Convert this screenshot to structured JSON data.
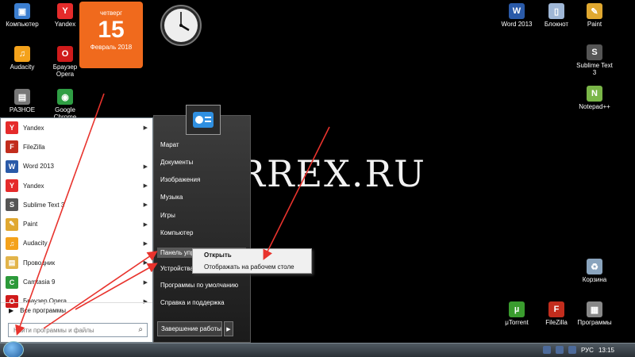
{
  "desktop": {
    "left_icons": [
      {
        "label": "Компьютер",
        "glyph": "▣",
        "color": "#3b7ed0"
      },
      {
        "label": "Yandex",
        "glyph": "Y",
        "color": "#e52b2b"
      },
      {
        "label": "Audacity",
        "glyph": "♫",
        "color": "#f4a21b"
      },
      {
        "label": "Браузер Opera",
        "glyph": "O",
        "color": "#d01b1b"
      },
      {
        "label": "РАЗНОЕ",
        "glyph": "▤",
        "color": "#777777"
      },
      {
        "label": "Google Chrome",
        "glyph": "◉",
        "color": "#2f9e44"
      }
    ],
    "right_icons": [
      {
        "label": "Word 2013",
        "glyph": "W",
        "color": "#2a5aa8"
      },
      {
        "label": "Блокнот",
        "glyph": "▯",
        "color": "#9fb7d6"
      },
      {
        "label": "Paint",
        "glyph": "✎",
        "color": "#e0a830"
      },
      {
        "label": "Sublime Text 3",
        "glyph": "S",
        "color": "#555555"
      },
      {
        "label": "Notepad++",
        "glyph": "N",
        "color": "#7ab648"
      },
      {
        "label": "Корзина",
        "glyph": "♻",
        "color": "#8aa4bd"
      },
      {
        "label": "μTorrent",
        "glyph": "µ",
        "color": "#3a9c2e"
      },
      {
        "label": "FileZilla",
        "glyph": "F",
        "color": "#c22d1d"
      },
      {
        "label": "Программы",
        "glyph": "▦",
        "color": "#888888"
      }
    ],
    "calendar": {
      "weekday": "четверг",
      "day": "15",
      "month_year": "Февраль 2018"
    },
    "watermark": "MARREX.RU"
  },
  "start_menu": {
    "programs": [
      {
        "label": "Yandex",
        "glyph": "Y",
        "color": "#e52b2b",
        "submenu": true
      },
      {
        "label": "FileZilla",
        "glyph": "F",
        "color": "#c22d1d",
        "submenu": false
      },
      {
        "label": "Word 2013",
        "glyph": "W",
        "color": "#2a5aa8",
        "submenu": true
      },
      {
        "label": "Yandex",
        "glyph": "Y",
        "color": "#e52b2b",
        "submenu": true
      },
      {
        "label": "Sublime Text 3",
        "glyph": "S",
        "color": "#555555",
        "submenu": true
      },
      {
        "label": "Paint",
        "glyph": "✎",
        "color": "#e0a830",
        "submenu": true
      },
      {
        "label": "Audacity",
        "glyph": "♫",
        "color": "#f4a21b",
        "submenu": true
      },
      {
        "label": "Проводник",
        "glyph": "▤",
        "color": "#e2b44a",
        "submenu": true
      },
      {
        "label": "Camtasia 9",
        "glyph": "C",
        "color": "#2c9a3a",
        "submenu": true
      },
      {
        "label": "Браузер Opera",
        "glyph": "O",
        "color": "#d01b1b",
        "submenu": true
      }
    ],
    "all_programs": "Все программы",
    "search_placeholder": "Найти программы и файлы",
    "right_links": [
      "Марат",
      "Документы",
      "Изображения",
      "Музыка",
      "Игры",
      "Компьютер",
      "Панель управления",
      "Устройства и принтеры",
      "Программы по умолчанию",
      "Справка и поддержка"
    ],
    "shutdown_label": "Завершение работы"
  },
  "context_menu": {
    "items": [
      "Открыть",
      "Отображать на рабочем столе"
    ]
  },
  "taskbar": {
    "language": "РУС",
    "time": "13:15"
  }
}
